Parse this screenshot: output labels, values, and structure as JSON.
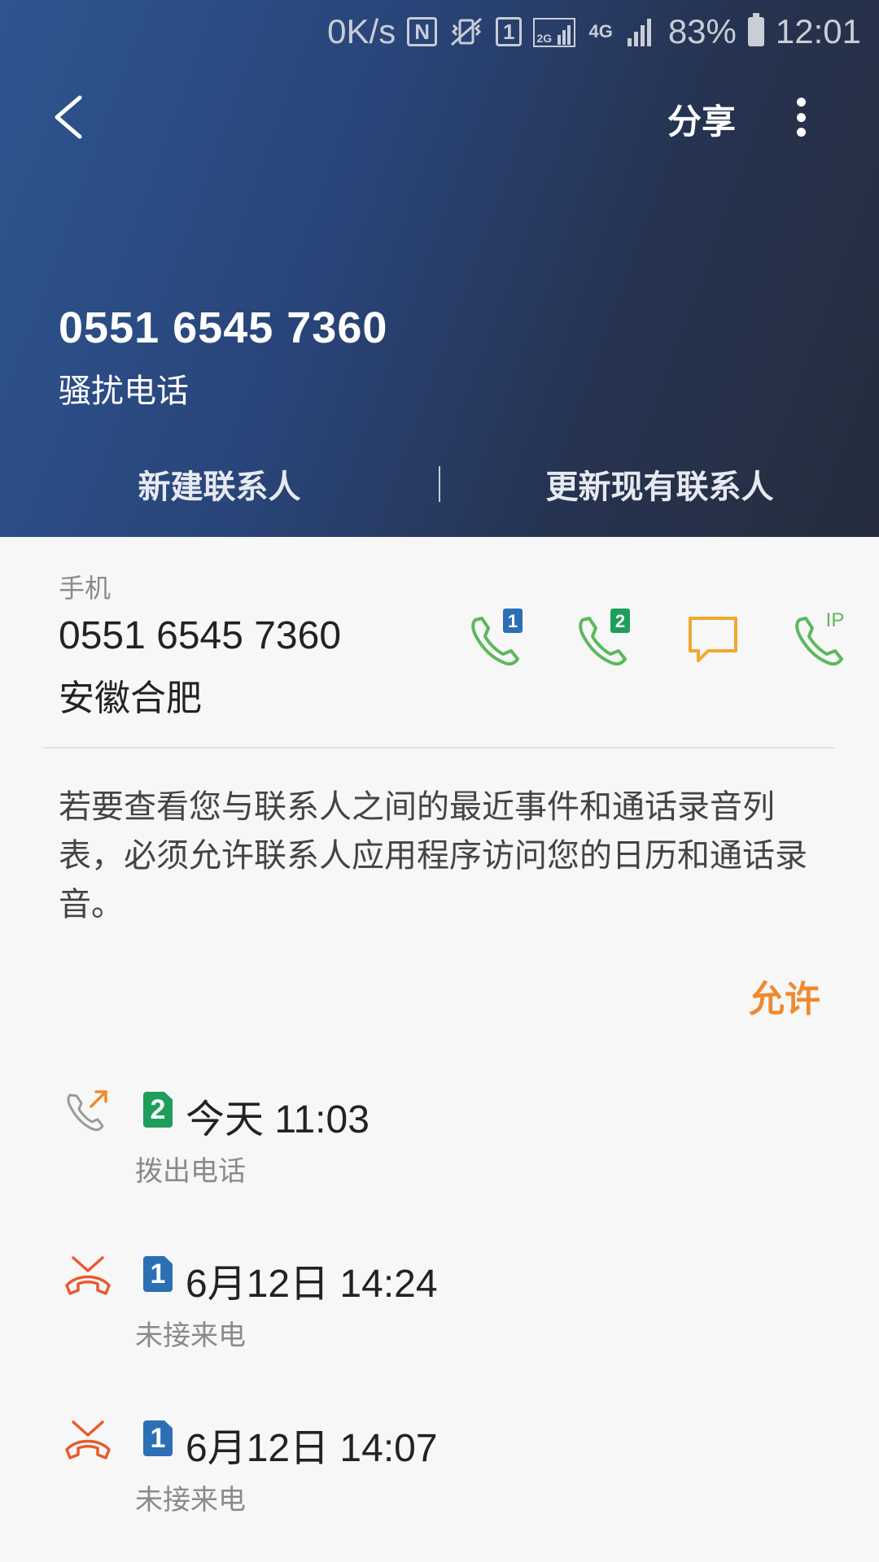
{
  "status_bar": {
    "net_speed": "0K/s",
    "nfc": "N",
    "sim1": "1",
    "network_2g": "2G",
    "network_4g": "4G",
    "battery": "83%",
    "time": "12:01"
  },
  "header": {
    "share_label": "分享",
    "number": "0551 6545 7360",
    "label": "骚扰电话",
    "new_contact_label": "新建联系人",
    "update_contact_label": "更新现有联系人",
    "gradient": [
      "#2e5590",
      "#252d3d"
    ]
  },
  "phone": {
    "type": "手机",
    "number": "0551 6545 7360",
    "location": "安徽合肥",
    "actions": [
      {
        "icon": "call-sim1-icon",
        "badge": "1",
        "color": "#5cb85c"
      },
      {
        "icon": "call-sim2-icon",
        "badge": "2",
        "color": "#5cb85c"
      },
      {
        "icon": "message-icon",
        "color": "#f0a830"
      },
      {
        "icon": "ip-call-icon",
        "badge": "IP",
        "color": "#5cb85c"
      }
    ]
  },
  "permission": {
    "text": "若要查看您与联系人之间的最近事件和通话录音列表，必须允许联系人应用程序访问您的日历和通话录音。",
    "allow_label": "允许",
    "accent": "#f0892e"
  },
  "call_log": [
    {
      "icon": "outgoing-call-icon",
      "sim": "2",
      "sim_color": "#1e9e5a",
      "time": "今天 11:03",
      "type": "拨出电话"
    },
    {
      "icon": "missed-call-icon",
      "sim": "1",
      "sim_color": "#2d6fb5",
      "time": "6月12日 14:24",
      "type": "未接来电"
    },
    {
      "icon": "missed-call-icon",
      "sim": "1",
      "sim_color": "#2d6fb5",
      "time": "6月12日 14:07",
      "type": "未接来电"
    }
  ]
}
